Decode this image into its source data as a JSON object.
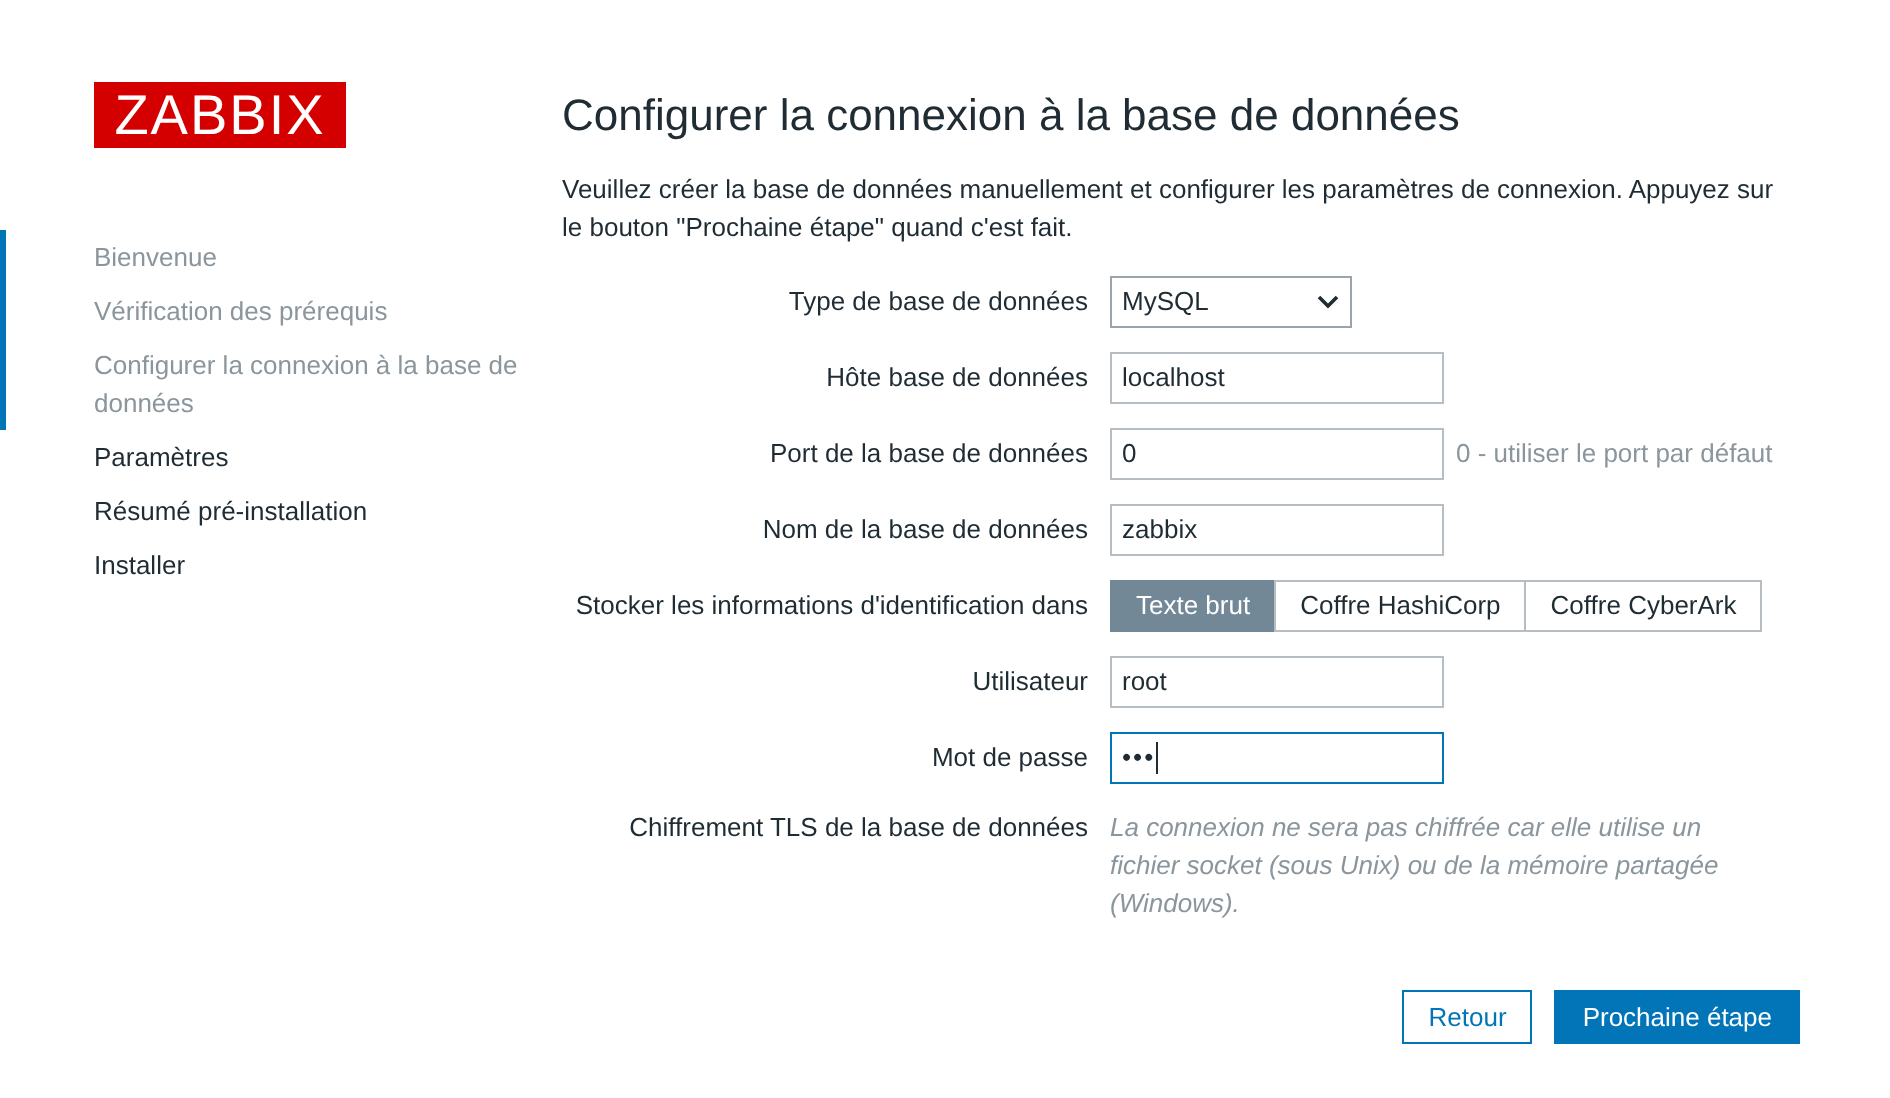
{
  "logo": "ZABBIX",
  "steps": [
    {
      "label": "Bienvenue",
      "done": true
    },
    {
      "label": "Vérification des prérequis",
      "done": true
    },
    {
      "label": "Configurer la connexion à la base de données",
      "done": true
    },
    {
      "label": "Paramètres",
      "done": false
    },
    {
      "label": "Résumé pré-installation",
      "done": false
    },
    {
      "label": "Installer",
      "done": false
    }
  ],
  "title": "Configurer la connexion à la base de données",
  "intro": "Veuillez créer la base de données manuellement et configurer les paramètres de connexion. Appuyez sur le bouton \"Prochaine étape\" quand c'est fait.",
  "fields": [
    {
      "kind": "select",
      "label": "Type de base de données",
      "value": "MySQL"
    },
    {
      "kind": "text",
      "label": "Hôte base de données",
      "value": "localhost",
      "focused": false
    },
    {
      "kind": "text",
      "label": "Port de la base de données",
      "value": "0",
      "hint": "0 - utiliser le port par défaut",
      "focused": false
    },
    {
      "kind": "text",
      "label": "Nom de la base de données",
      "value": "zabbix",
      "focused": false
    },
    {
      "kind": "segmented",
      "label": "Stocker les informations d'identification dans",
      "options": [
        {
          "label": "Texte brut",
          "selected": true
        },
        {
          "label": "Coffre HashiCorp",
          "selected": false
        },
        {
          "label": "Coffre CyberArk",
          "selected": false
        }
      ]
    },
    {
      "kind": "text",
      "label": "Utilisateur",
      "value": "root",
      "focused": false
    },
    {
      "kind": "password",
      "label": "Mot de passe",
      "value": "•••",
      "focused": true
    },
    {
      "kind": "note",
      "label": "Chiffrement TLS de la base de données",
      "text": "La connexion ne sera pas chiffrée car elle utilise un fichier socket (sous Unix) ou de la mémoire partagée (Windows)."
    }
  ],
  "buttons": [
    {
      "label": "Retour",
      "kind": "secondary"
    },
    {
      "label": "Prochaine étape",
      "kind": "primary"
    }
  ]
}
